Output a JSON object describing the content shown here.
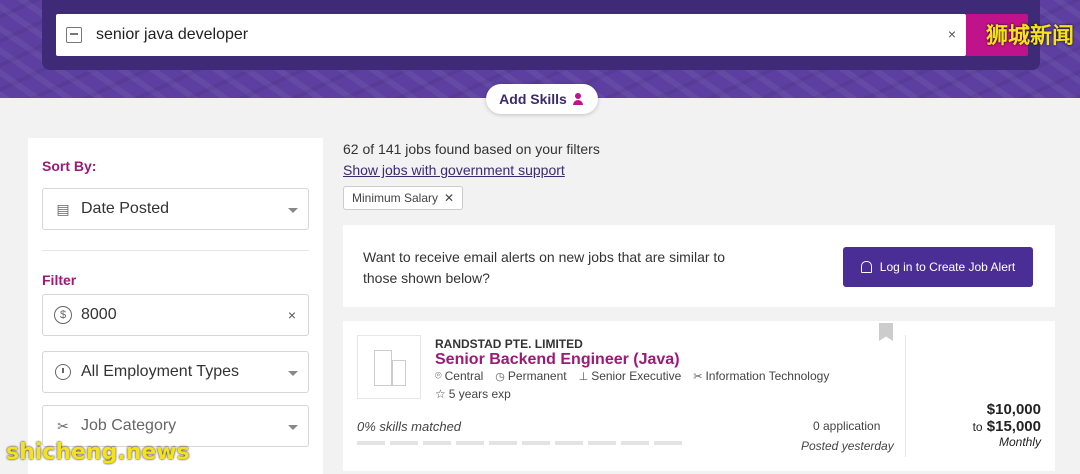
{
  "search": {
    "query": "senior java developer",
    "clear_glyph": "×"
  },
  "watermarks": {
    "top": "狮城新闻",
    "bottom": "shicheng.news"
  },
  "skills_pill": {
    "label": "Add Skills",
    "icon": "person-icon"
  },
  "sidebar": {
    "sort_label": "Sort By:",
    "sort_value": "Date Posted",
    "filter_label": "Filter",
    "salary_value": "8000",
    "salary_clear": "×",
    "employment_value": "All Employment Types",
    "category_value": "Job Category"
  },
  "results": {
    "count_text": "62 of 141 jobs found based on your filters",
    "gov_link": "Show jobs with government support",
    "chip_label": "Minimum Salary",
    "chip_remove": "✕"
  },
  "alert": {
    "text": "Want to receive email alerts on new jobs that are similar to those shown below?",
    "button_label": "Log in to Create Job Alert"
  },
  "job": {
    "company": "RANDSTAD PTE. LIMITED",
    "title": "Senior Backend Engineer (Java)",
    "location": "Central",
    "employment": "Permanent",
    "level": "Senior Executive",
    "category": "Information Technology",
    "experience": "5 years exp",
    "skills_matched": "0% skills matched",
    "applications": "0 application",
    "posted": "Posted yesterday",
    "salary_min": "$10,000",
    "salary_to": "to",
    "salary_max": "$15,000",
    "salary_period": "Monthly"
  },
  "colors": {
    "accent": "#9b1a78",
    "header": "#5c3fa0",
    "button": "#4b2d96"
  }
}
